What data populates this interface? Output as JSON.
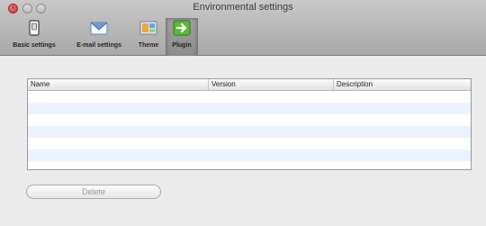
{
  "window": {
    "title": "Environmental settings"
  },
  "toolbar": {
    "items": [
      {
        "label": "Basic settings",
        "icon": "switch-icon"
      },
      {
        "label": "E-mail settings",
        "icon": "envelope-icon"
      },
      {
        "label": "Theme",
        "icon": "palette-icon"
      },
      {
        "label": "Plugin",
        "icon": "plugin-arrow-icon",
        "selected": true
      }
    ]
  },
  "table": {
    "columns": [
      "Name",
      "Version",
      "Description"
    ],
    "rows": []
  },
  "buttons": {
    "delete_label": "Delete",
    "delete_enabled": false
  },
  "colors": {
    "row_stripe": "#edf3fe",
    "plugin_icon_green": "#5cb83a"
  }
}
